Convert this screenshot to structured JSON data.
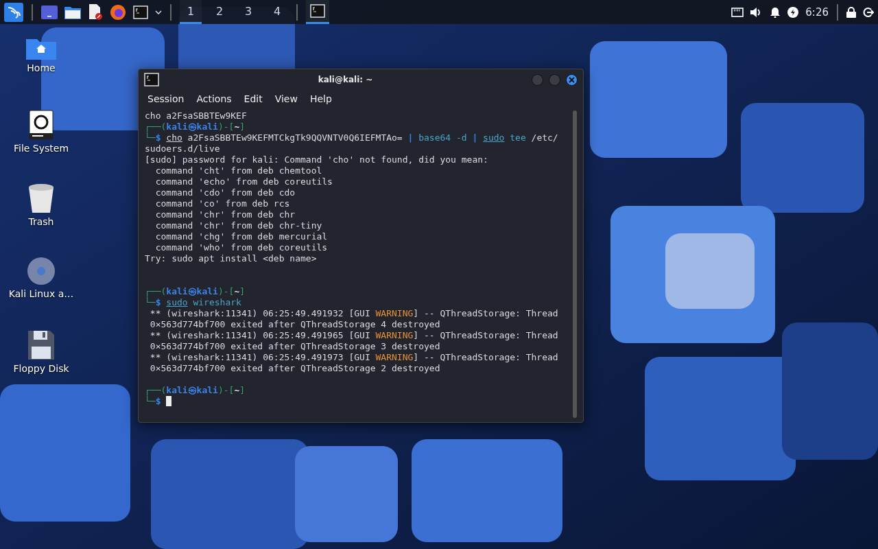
{
  "taskbar": {
    "workspaces": [
      {
        "label": "1",
        "selected": true
      },
      {
        "label": "2",
        "selected": false
      },
      {
        "label": "3",
        "selected": false
      },
      {
        "label": "4",
        "selected": false
      }
    ],
    "tasks": [
      {
        "selected": true
      }
    ],
    "clock": "6:26"
  },
  "desktop_icons": [
    {
      "label": "Home",
      "kind": "home"
    },
    {
      "label": "File System",
      "kind": "drive"
    },
    {
      "label": "Trash",
      "kind": "trash"
    },
    {
      "label": "Kali Linux a…",
      "kind": "disc"
    },
    {
      "label": "Floppy Disk",
      "kind": "floppy"
    }
  ],
  "window": {
    "title": "kali@kali: ~",
    "menu": [
      "Session",
      "Actions",
      "Edit",
      "View",
      "Help"
    ],
    "lines": [
      {
        "kind": "text",
        "segs": [
          {
            "kind": "plain",
            "text": "cho a2FsaSBBTEw9KEF"
          }
        ]
      },
      {
        "kind": "text",
        "segs": [
          {
            "kind": "green",
            "text": "┌──("
          },
          {
            "kind": "blue",
            "text": "kali㉿kali"
          },
          {
            "kind": "green",
            "text": ")-["
          },
          {
            "kind": "bold",
            "text": "~"
          },
          {
            "kind": "green",
            "text": "]"
          }
        ]
      },
      {
        "kind": "text",
        "segs": [
          {
            "kind": "green",
            "text": "└─"
          },
          {
            "kind": "blue",
            "text": "$ "
          },
          {
            "kind": "under",
            "text": "cho"
          },
          {
            "kind": "plain",
            "text": " a2FsaSBBTEw9KEFMTCkgTk9QQVNTV0Q6IEFMTAo= "
          },
          {
            "kind": "blue",
            "text": "|"
          },
          {
            "kind": "cyan",
            "text": " base64 -d "
          },
          {
            "kind": "blue",
            "text": "| "
          },
          {
            "kind": "cyanunder",
            "text": "sudo"
          },
          {
            "kind": "cyan",
            "text": " tee"
          },
          {
            "kind": "plain",
            "text": " /etc/"
          }
        ]
      },
      {
        "kind": "text",
        "segs": [
          {
            "kind": "plain",
            "text": "sudoers.d/live"
          }
        ]
      },
      {
        "kind": "text",
        "segs": [
          {
            "kind": "plain",
            "text": "[sudo] password for kali: Command 'cho' not found, did you mean:"
          }
        ]
      },
      {
        "kind": "text",
        "segs": [
          {
            "kind": "plain",
            "text": "  command 'cht' from deb chemtool"
          }
        ]
      },
      {
        "kind": "text",
        "segs": [
          {
            "kind": "plain",
            "text": "  command 'echo' from deb coreutils"
          }
        ]
      },
      {
        "kind": "text",
        "segs": [
          {
            "kind": "plain",
            "text": "  command 'cdo' from deb cdo"
          }
        ]
      },
      {
        "kind": "text",
        "segs": [
          {
            "kind": "plain",
            "text": "  command 'co' from deb rcs"
          }
        ]
      },
      {
        "kind": "text",
        "segs": [
          {
            "kind": "plain",
            "text": "  command 'chr' from deb chr"
          }
        ]
      },
      {
        "kind": "text",
        "segs": [
          {
            "kind": "plain",
            "text": "  command 'chr' from deb chr-tiny"
          }
        ]
      },
      {
        "kind": "text",
        "segs": [
          {
            "kind": "plain",
            "text": "  command 'chg' from deb mercurial"
          }
        ]
      },
      {
        "kind": "text",
        "segs": [
          {
            "kind": "plain",
            "text": "  command 'who' from deb coreutils"
          }
        ]
      },
      {
        "kind": "text",
        "segs": [
          {
            "kind": "plain",
            "text": "Try: sudo apt install <deb name>"
          }
        ]
      },
      {
        "kind": "blank"
      },
      {
        "kind": "blank"
      },
      {
        "kind": "text",
        "segs": [
          {
            "kind": "green",
            "text": "┌──("
          },
          {
            "kind": "blue",
            "text": "kali㉿kali"
          },
          {
            "kind": "green",
            "text": ")-["
          },
          {
            "kind": "bold",
            "text": "~"
          },
          {
            "kind": "green",
            "text": "]"
          }
        ]
      },
      {
        "kind": "text",
        "segs": [
          {
            "kind": "green",
            "text": "└─"
          },
          {
            "kind": "blue",
            "text": "$ "
          },
          {
            "kind": "cyanunder",
            "text": "sudo"
          },
          {
            "kind": "cyan",
            "text": " wireshark"
          }
        ]
      },
      {
        "kind": "text",
        "segs": [
          {
            "kind": "plain",
            "text": " ** (wireshark:11341) 06:25:49.491932 [GUI "
          },
          {
            "kind": "orange",
            "text": "WARNING"
          },
          {
            "kind": "plain",
            "text": "] -- QThreadStorage: Thread"
          }
        ]
      },
      {
        "kind": "text",
        "segs": [
          {
            "kind": "plain",
            "text": " 0×563d774bf700 exited after QThreadStorage 4 destroyed"
          }
        ]
      },
      {
        "kind": "text",
        "segs": [
          {
            "kind": "plain",
            "text": " ** (wireshark:11341) 06:25:49.491965 [GUI "
          },
          {
            "kind": "orange",
            "text": "WARNING"
          },
          {
            "kind": "plain",
            "text": "] -- QThreadStorage: Thread"
          }
        ]
      },
      {
        "kind": "text",
        "segs": [
          {
            "kind": "plain",
            "text": " 0×563d774bf700 exited after QThreadStorage 3 destroyed"
          }
        ]
      },
      {
        "kind": "text",
        "segs": [
          {
            "kind": "plain",
            "text": " ** (wireshark:11341) 06:25:49.491973 [GUI "
          },
          {
            "kind": "orange",
            "text": "WARNING"
          },
          {
            "kind": "plain",
            "text": "] -- QThreadStorage: Thread"
          }
        ]
      },
      {
        "kind": "text",
        "segs": [
          {
            "kind": "plain",
            "text": " 0×563d774bf700 exited after QThreadStorage 2 destroyed"
          }
        ]
      },
      {
        "kind": "blank"
      },
      {
        "kind": "text",
        "segs": [
          {
            "kind": "green",
            "text": "┌──("
          },
          {
            "kind": "blue",
            "text": "kali㉿kali"
          },
          {
            "kind": "green",
            "text": ")-["
          },
          {
            "kind": "bold",
            "text": "~"
          },
          {
            "kind": "green",
            "text": "]"
          }
        ]
      },
      {
        "kind": "text",
        "segs": [
          {
            "kind": "green",
            "text": "└─"
          },
          {
            "kind": "blue",
            "text": "$ "
          }
        ],
        "cursor": true
      }
    ]
  }
}
